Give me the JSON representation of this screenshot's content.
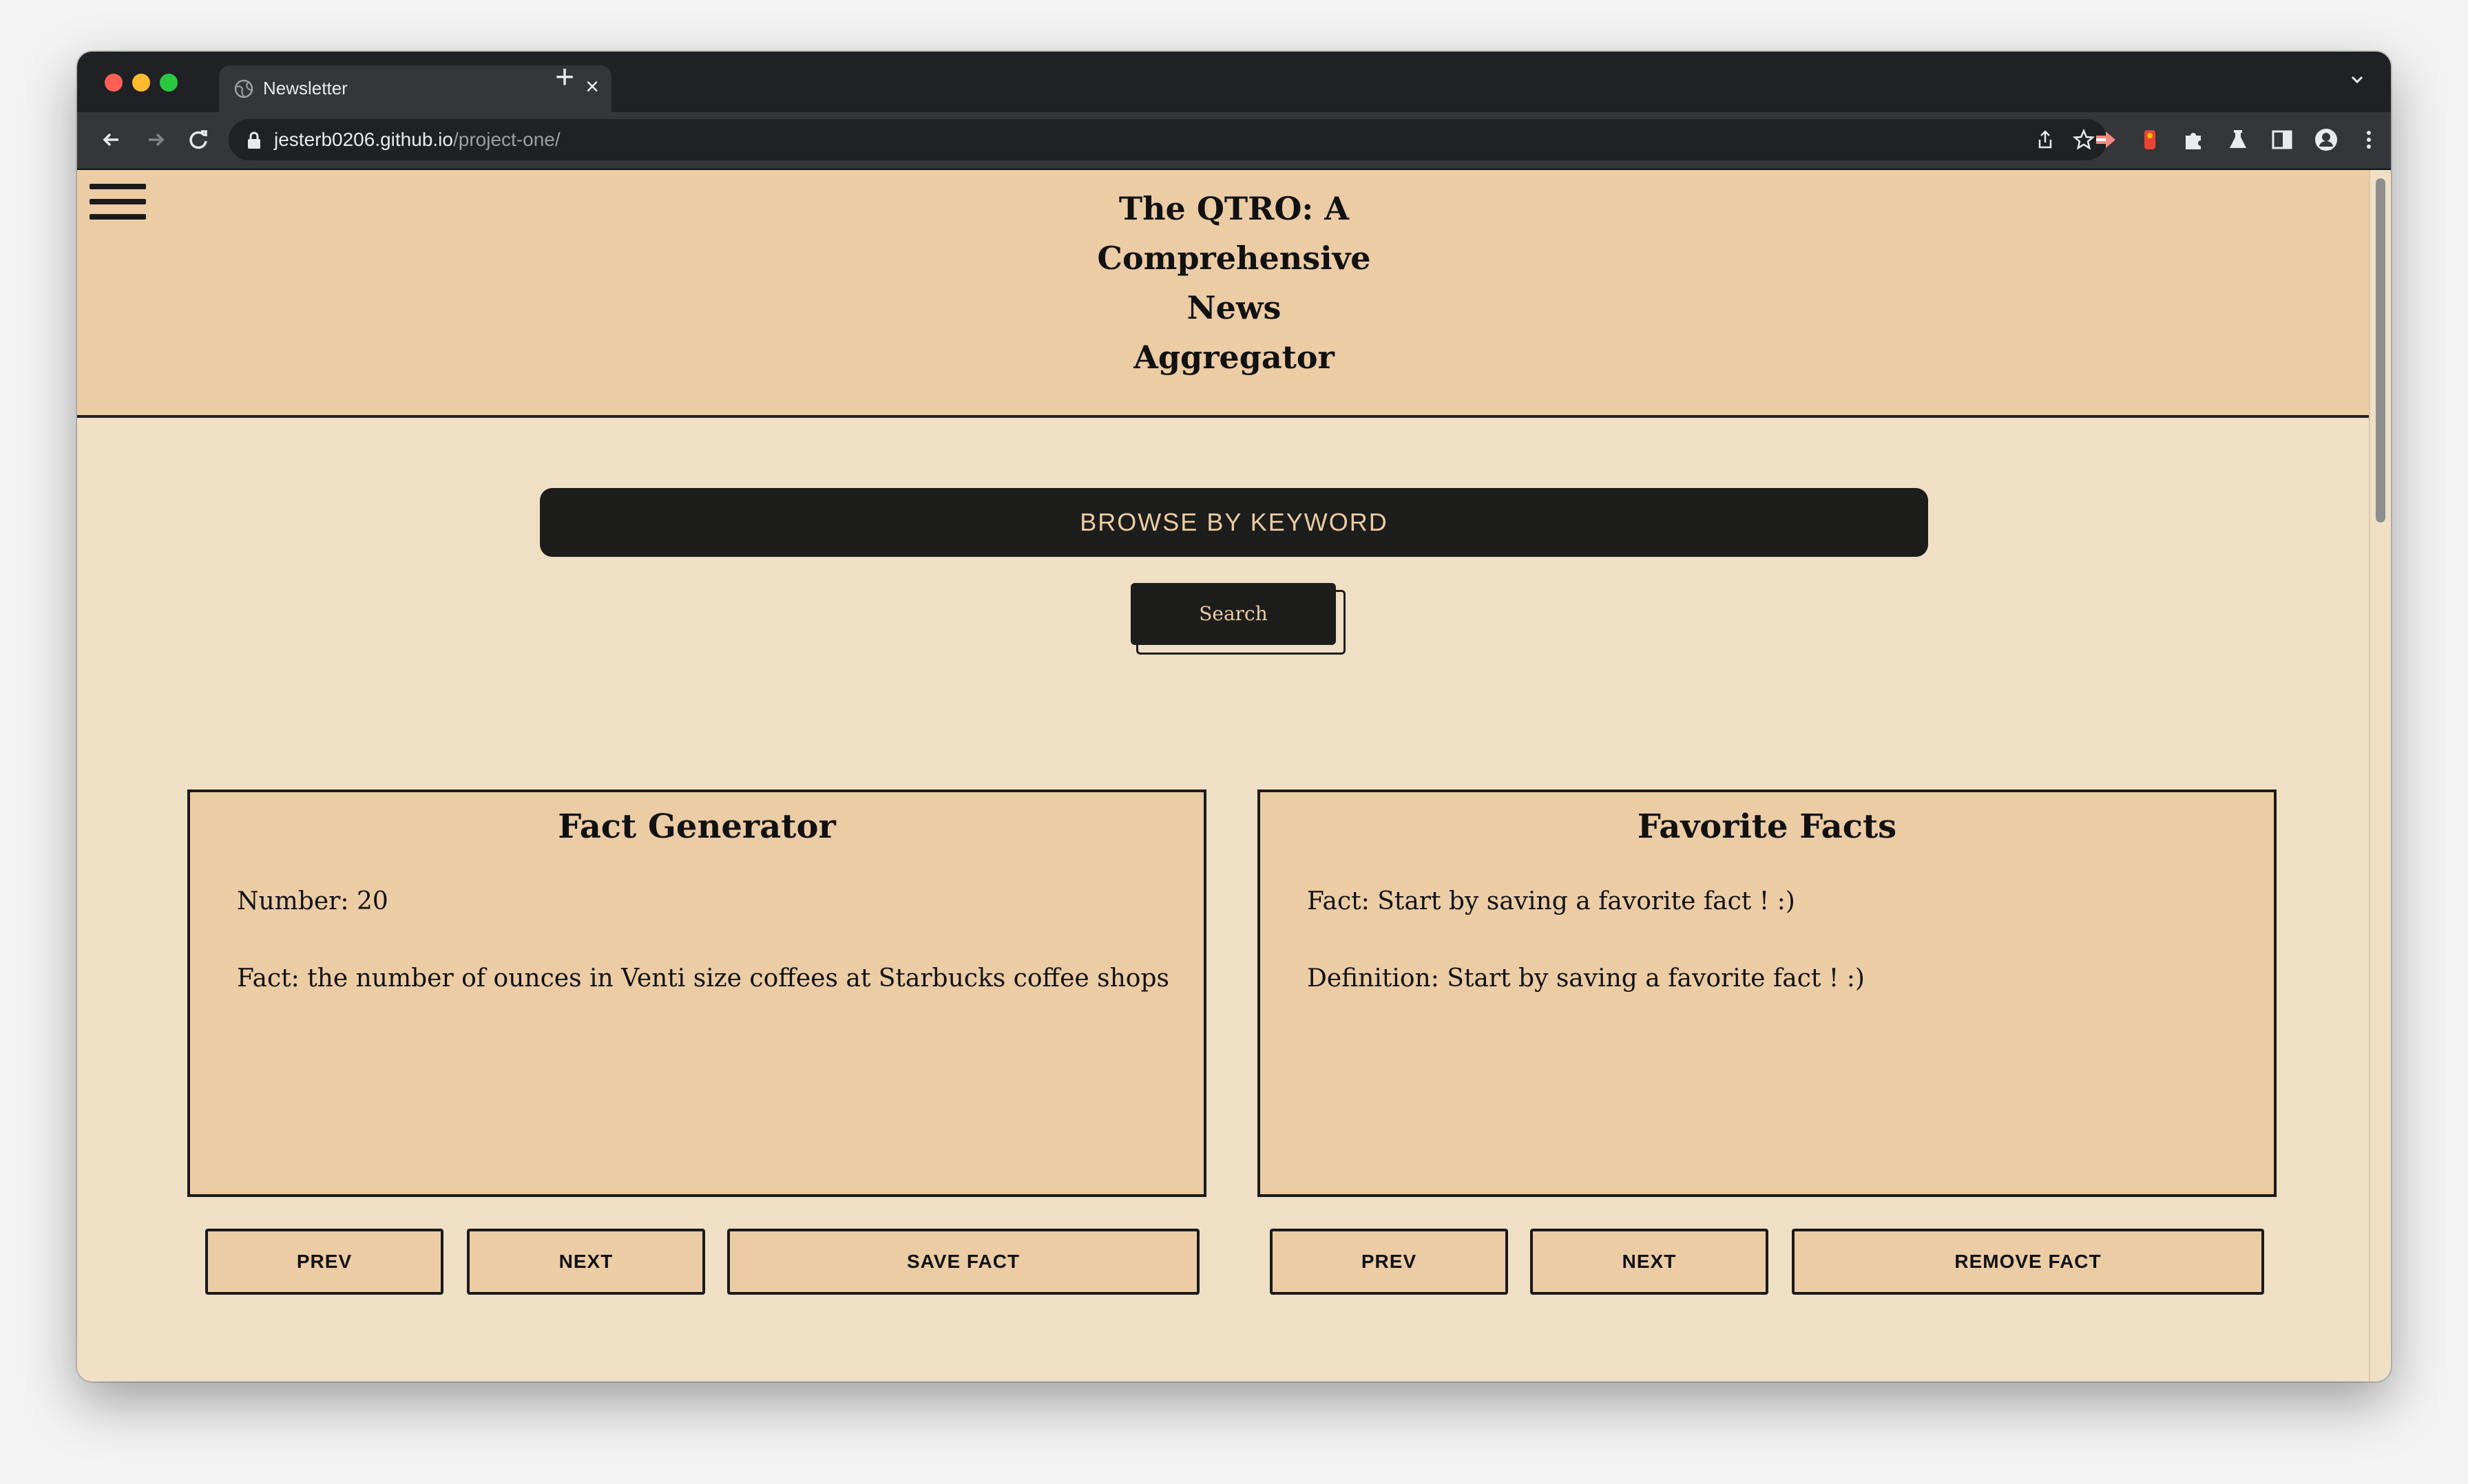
{
  "browser": {
    "tab_title": "Newsletter",
    "url_host": "jesterb0206.github.io",
    "url_path": "/project-one/"
  },
  "header": {
    "title_lines": [
      "The QTRO: A",
      "Comprehensive",
      "News",
      "Aggregator"
    ]
  },
  "search": {
    "browse_label": "BROWSE BY KEYWORD",
    "search_label": "Search"
  },
  "fact_generator": {
    "title": "Fact Generator",
    "number_line": "Number: 20",
    "fact_line": "Fact: the number of ounces in Venti size coffees at Starbucks coffee shops",
    "prev_label": "PREV",
    "next_label": "NEXT",
    "save_label": "SAVE FACT"
  },
  "favorite_facts": {
    "title": "Favorite Facts",
    "fact_line": "Fact: Start by saving a favorite fact ! :)",
    "definition_line": "Definition: Start by saving a favorite fact ! :)",
    "prev_label": "PREV",
    "next_label": "NEXT",
    "remove_label": "REMOVE FACT"
  },
  "colors": {
    "header_bg": "#eccca5",
    "page_bg": "#efdfc4",
    "dark": "#1d1d1b"
  }
}
